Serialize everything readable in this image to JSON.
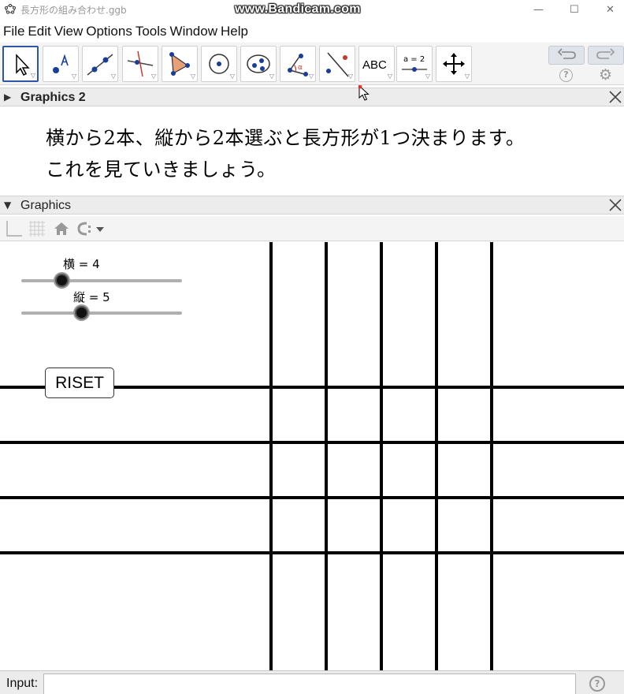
{
  "window": {
    "title": "長方形の組み合わせ.ggb",
    "watermark": "www.Bandicam.com",
    "minimize": "—",
    "maximize": "☐",
    "close": "✕"
  },
  "menu": [
    "File",
    "Edit",
    "View",
    "Options",
    "Tools",
    "Window",
    "Help"
  ],
  "toolbar": {
    "text_tool_label": "ABC",
    "slider_tool_label": "a = 2"
  },
  "graphics2": {
    "title": "Graphics 2",
    "text_line1": "横から2本、縦から2本選ぶと長方形が1つ決まります。",
    "text_line2": "これを見ていきましょう。"
  },
  "graphics": {
    "title": "Graphics",
    "slider_yoko": {
      "label": "横 = 4",
      "value": 4,
      "min": 1,
      "max": 10
    },
    "slider_tate": {
      "label": "縦 = 5",
      "value": 5,
      "min": 1,
      "max": 10
    },
    "reset_button": "RISET",
    "horizontal_lines": 4,
    "vertical_lines": 5
  },
  "input": {
    "label": "Input:",
    "value": "",
    "help": "?"
  }
}
